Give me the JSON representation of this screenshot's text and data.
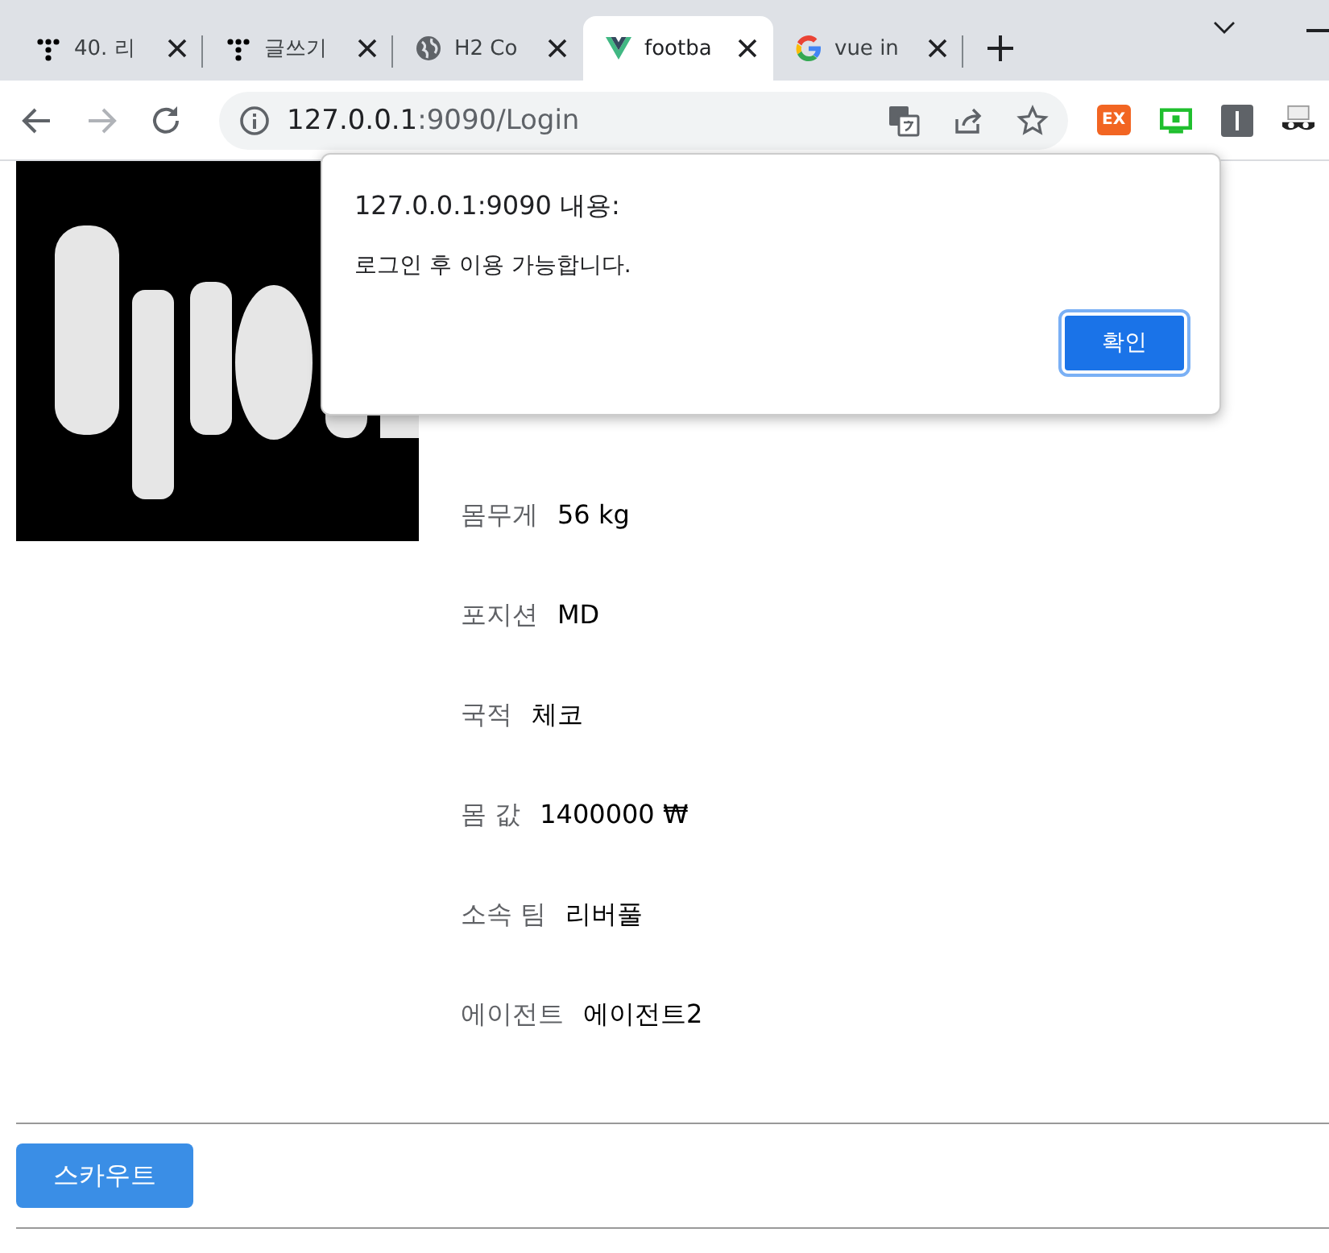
{
  "browser": {
    "tabs": [
      {
        "title": "40. 리",
        "kind": "dots",
        "selected": false
      },
      {
        "title": "글쓰기",
        "kind": "dots",
        "selected": false
      },
      {
        "title": "H2 Co",
        "kind": "globe",
        "selected": false
      },
      {
        "title": "footba",
        "kind": "vue",
        "selected": true
      },
      {
        "title": "vue in",
        "kind": "google",
        "selected": false
      }
    ],
    "address": {
      "host": "127.0.0.1",
      "rest": ":9090/Login"
    },
    "extensions": [
      {
        "kind": "badge",
        "label": "EX"
      },
      {
        "kind": "screen"
      },
      {
        "kind": "bar"
      },
      {
        "kind": "mask"
      }
    ]
  },
  "page": {
    "fields": [
      {
        "label": "몸무게",
        "value": "56 kg"
      },
      {
        "label": "포지션",
        "value": "MD"
      },
      {
        "label": "국적",
        "value": "체코"
      },
      {
        "label": "몸 값",
        "value": "1400000 ₩"
      },
      {
        "label": "소속 팀",
        "value": "리버풀"
      },
      {
        "label": "에이전트",
        "value": "에이전트2"
      }
    ],
    "button": "스카우트"
  },
  "dialog": {
    "title": "127.0.0.1:9090 내용:",
    "message": "로그인 후 이용 가능합니다.",
    "button": "확인"
  }
}
